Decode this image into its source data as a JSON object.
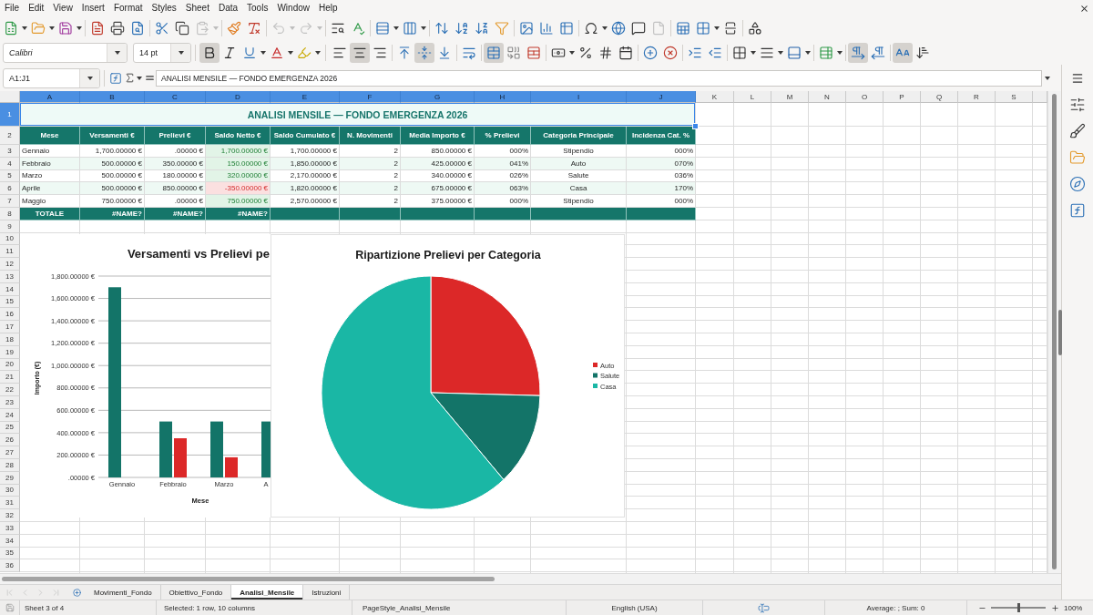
{
  "menu_bar": [
    "File",
    "Edit",
    "View",
    "Insert",
    "Format",
    "Styles",
    "Sheet",
    "Data",
    "Tools",
    "Window",
    "Help"
  ],
  "standard_toolbar": [
    {
      "kind": "new",
      "disabled": false
    },
    {
      "kind": "open",
      "disabled": false
    },
    {
      "kind": "save",
      "disabled": false
    },
    {
      "kind": "pdf",
      "disabled": false
    },
    {
      "kind": "print",
      "disabled": false
    },
    {
      "kind": "preview",
      "disabled": false
    },
    {
      "kind": "cut",
      "disabled": false
    },
    {
      "kind": "copy",
      "disabled": false
    },
    {
      "kind": "paste",
      "disabled": true
    },
    {
      "kind": "clone",
      "disabled": false
    },
    {
      "kind": "clear",
      "disabled": false
    },
    {
      "kind": "undo",
      "disabled": true
    },
    {
      "kind": "redo",
      "disabled": true
    },
    {
      "kind": "find",
      "disabled": false
    },
    {
      "kind": "spelling",
      "disabled": false
    },
    {
      "kind": "rows",
      "disabled": false
    },
    {
      "kind": "columns",
      "disabled": false
    },
    {
      "kind": "sort",
      "disabled": false
    },
    {
      "kind": "ascending",
      "disabled": false
    },
    {
      "kind": "descending",
      "disabled": false
    },
    {
      "kind": "filter",
      "disabled": false
    },
    {
      "kind": "image",
      "disabled": false
    },
    {
      "kind": "chart",
      "disabled": false
    },
    {
      "kind": "pivot",
      "disabled": false
    },
    {
      "kind": "symbol",
      "disabled": false
    },
    {
      "kind": "hyperlink",
      "disabled": false
    },
    {
      "kind": "comment",
      "disabled": false
    },
    {
      "kind": "headers",
      "disabled": true
    },
    {
      "kind": "printarea",
      "disabled": false
    },
    {
      "kind": "freeze",
      "disabled": false
    },
    {
      "kind": "split",
      "disabled": false
    },
    {
      "kind": "draw",
      "disabled": false
    }
  ],
  "formatting_toolbar": {
    "font_name": "Calibri",
    "font_size": "14 pt",
    "buttons": [
      {
        "kind": "bold",
        "pressed": true
      },
      {
        "kind": "italic",
        "pressed": false
      },
      {
        "kind": "underline",
        "pressed": false
      },
      {
        "kind": "fontcolor",
        "pressed": false
      },
      {
        "kind": "highlight",
        "pressed": false
      },
      {
        "kind": "left",
        "pressed": false
      },
      {
        "kind": "center",
        "pressed": true
      },
      {
        "kind": "right",
        "pressed": false
      },
      {
        "kind": "top",
        "pressed": false
      },
      {
        "kind": "middle",
        "pressed": true
      },
      {
        "kind": "bottom",
        "pressed": false
      },
      {
        "kind": "wrap",
        "pressed": false
      },
      {
        "kind": "mergecenter",
        "pressed": true
      },
      {
        "kind": "merge",
        "pressed": false
      },
      {
        "kind": "unmerge",
        "pressed": false
      },
      {
        "kind": "currency",
        "pressed": false
      },
      {
        "kind": "percent",
        "pressed": false
      },
      {
        "kind": "number",
        "pressed": false
      },
      {
        "kind": "date",
        "pressed": false
      },
      {
        "kind": "adddecimal",
        "pressed": false
      },
      {
        "kind": "deldecimal",
        "pressed": false
      },
      {
        "kind": "indent",
        "pressed": false
      },
      {
        "kind": "outdent",
        "pressed": false
      },
      {
        "kind": "borders",
        "pressed": false
      },
      {
        "kind": "borderstyle",
        "pressed": false
      },
      {
        "kind": "bordercolor",
        "pressed": false
      },
      {
        "kind": "conditional",
        "pressed": false
      },
      {
        "kind": "ltr",
        "pressed": true
      },
      {
        "kind": "rtl",
        "pressed": false
      },
      {
        "kind": "orientation",
        "pressed": true
      },
      {
        "kind": "vertical",
        "pressed": false
      }
    ]
  },
  "formula_bar": {
    "name_box": "A1:J1",
    "content": "ANALISI MENSILE — FONDO EMERGENZA 2026"
  },
  "sheet": {
    "columns": [
      {
        "label": "A",
        "selected": true
      },
      {
        "label": "B",
        "selected": true
      },
      {
        "label": "C",
        "selected": true
      },
      {
        "label": "D",
        "selected": true
      },
      {
        "label": "E",
        "selected": true
      },
      {
        "label": "F",
        "selected": true
      },
      {
        "label": "G",
        "selected": true
      },
      {
        "label": "H",
        "selected": true
      },
      {
        "label": "I",
        "selected": true
      },
      {
        "label": "J",
        "selected": true
      },
      {
        "label": "K",
        "selected": false
      },
      {
        "label": "L",
        "selected": false
      },
      {
        "label": "M",
        "selected": false
      },
      {
        "label": "N",
        "selected": false
      },
      {
        "label": "O",
        "selected": false
      },
      {
        "label": "P",
        "selected": false
      },
      {
        "label": "Q",
        "selected": false
      },
      {
        "label": "R",
        "selected": false
      },
      {
        "label": "S",
        "selected": false
      }
    ],
    "rows": [
      {
        "label": "1",
        "selected": true
      },
      {
        "label": "2",
        "selected": false
      },
      {
        "label": "3",
        "selected": false
      },
      {
        "label": "4",
        "selected": false
      },
      {
        "label": "5",
        "selected": false
      },
      {
        "label": "6",
        "selected": false
      },
      {
        "label": "7",
        "selected": false
      },
      {
        "label": "8",
        "selected": false
      },
      {
        "label": "9",
        "selected": false
      },
      {
        "label": "10",
        "selected": false
      },
      {
        "label": "11",
        "selected": false
      },
      {
        "label": "12",
        "selected": false
      },
      {
        "label": "13",
        "selected": false
      },
      {
        "label": "14",
        "selected": false
      },
      {
        "label": "15",
        "selected": false
      },
      {
        "label": "16",
        "selected": false
      },
      {
        "label": "17",
        "selected": false
      },
      {
        "label": "18",
        "selected": false
      },
      {
        "label": "19",
        "selected": false
      },
      {
        "label": "20",
        "selected": false
      },
      {
        "label": "21",
        "selected": false
      },
      {
        "label": "22",
        "selected": false
      },
      {
        "label": "23",
        "selected": false
      },
      {
        "label": "24",
        "selected": false
      },
      {
        "label": "25",
        "selected": false
      },
      {
        "label": "26",
        "selected": false
      },
      {
        "label": "27",
        "selected": false
      },
      {
        "label": "28",
        "selected": false
      },
      {
        "label": "29",
        "selected": false
      },
      {
        "label": "30",
        "selected": false
      },
      {
        "label": "31",
        "selected": false
      },
      {
        "label": "32",
        "selected": false
      },
      {
        "label": "33",
        "selected": false
      },
      {
        "label": "34",
        "selected": false
      },
      {
        "label": "35",
        "selected": false
      },
      {
        "label": "36",
        "selected": false
      }
    ],
    "title": "ANALISI MENSILE — FONDO EMERGENZA 2026",
    "headers": [
      "Mese",
      "Versamenti €",
      "Prelievi €",
      "Saldo Netto €",
      "Saldo Cumulato €",
      "N. Movimenti",
      "Media Importo €",
      "% Prelievi",
      "Categoria Principale",
      "Incidenza Cat. %"
    ],
    "data": [
      {
        "cells": [
          "Gennaio",
          "1,700.00000 €",
          ".00000 €",
          "1,700.00000 €",
          "1,700.00000 €",
          "2",
          "850.00000 €",
          "000%",
          "Stipendio",
          "000%"
        ],
        "negative": false
      },
      {
        "cells": [
          "Febbraio",
          "500.00000 €",
          "350.00000 €",
          "150.00000 €",
          "1,850.00000 €",
          "2",
          "425.00000 €",
          "041%",
          "Auto",
          "070%"
        ],
        "negative": false
      },
      {
        "cells": [
          "Marzo",
          "500.00000 €",
          "180.00000 €",
          "320.00000 €",
          "2,170.00000 €",
          "2",
          "340.00000 €",
          "026%",
          "Salute",
          "036%"
        ],
        "negative": false
      },
      {
        "cells": [
          "Aprile",
          "500.00000 €",
          "850.00000 €",
          "-350.00000 €",
          "1,820.00000 €",
          "2",
          "675.00000 €",
          "063%",
          "Casa",
          "170%"
        ],
        "negative": true
      },
      {
        "cells": [
          "Maggio",
          "750.00000 €",
          ".00000 €",
          "750.00000 €",
          "2,570.00000 €",
          "2",
          "375.00000 €",
          "000%",
          "Stipendio",
          "000%"
        ],
        "negative": false
      }
    ],
    "totals": [
      "TOTALE",
      "#NAME?",
      "#NAME?",
      "#NAME?"
    ]
  },
  "charts": [
    {
      "chart_data": {
        "type": "bar",
        "title": "Versamenti vs Prelievi pe",
        "xlabel": "Mese",
        "ylabel": "Importo (€)",
        "categories": [
          "Gennaio",
          "Febbraio",
          "Marzo",
          "A"
        ],
        "series": [
          {
            "color": "#137468",
            "values": [
              1700,
              500,
              500,
              500
            ]
          },
          {
            "color": "#dc2828",
            "values": [
              0,
              350,
              180,
              null
            ]
          }
        ],
        "ylim": [
          0,
          1800
        ],
        "yticks": [
          {
            "value": 0,
            "label": ".00000 €"
          },
          {
            "value": 200,
            "label": "200.00000 €"
          },
          {
            "value": 400,
            "label": "400.00000 €"
          },
          {
            "value": 600,
            "label": "600.00000 €"
          },
          {
            "value": 800,
            "label": "800.00000 €"
          },
          {
            "value": 1000,
            "label": "1,000.00000 €"
          },
          {
            "value": 1200,
            "label": "1,200.00000 €"
          },
          {
            "value": 1400,
            "label": "1,400.00000 €"
          },
          {
            "value": 1600,
            "label": "1,600.00000 €"
          },
          {
            "value": 1800,
            "label": "1,800.00000 €"
          }
        ],
        "grid": true
      }
    },
    {
      "chart_data": {
        "type": "pie",
        "title": "Ripartizione Prelievi per Categoria",
        "categories": [
          "Auto",
          "Salute",
          "Casa"
        ],
        "values": [
          25.4,
          13,
          61.6
        ],
        "legend": "right"
      },
      "slices": [
        {
          "color": "#dc2828"
        },
        {
          "color": "#137468"
        },
        {
          "color": "#1ab7a5"
        }
      ]
    }
  ],
  "sheet_navigation": [
    {
      "kind": "first",
      "disabled": true
    },
    {
      "kind": "previous",
      "disabled": true
    },
    {
      "kind": "next",
      "disabled": true
    },
    {
      "kind": "last",
      "disabled": true
    }
  ],
  "sheet_tabs": [
    {
      "label": "Movimenti_Fondo",
      "selected": false
    },
    {
      "label": "Obiettivo_Fondo",
      "selected": false
    },
    {
      "label": "Analisi_Mensile",
      "selected": true
    },
    {
      "label": "Istruzioni",
      "selected": false
    }
  ],
  "status_bar": {
    "sheet": "Sheet 3 of 4",
    "selection": "Selected: 1 row, 10 columns",
    "page_style": "PageStyle_Analisi_Mensile",
    "language": "English (USA)",
    "summary": "Average: ; Sum: 0",
    "zoom": {
      "level": 0.5,
      "reading": "100%"
    }
  }
}
